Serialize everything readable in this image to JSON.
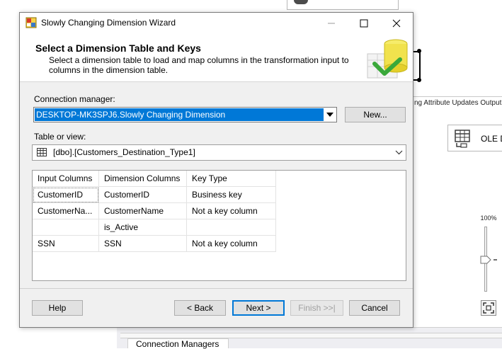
{
  "background": {
    "flow_label": "ng Attribute Updates Output",
    "ole_label": "OLE D",
    "zoom_label": "100%",
    "connection_managers_tab": "Connection Managers"
  },
  "dialog": {
    "title": "Slowly Changing Dimension Wizard",
    "header": {
      "title": "Select a Dimension Table and Keys",
      "description": "Select a dimension table to load and map columns in the transformation input to columns in the dimension table."
    },
    "connection_manager": {
      "label": "Connection manager:",
      "value": "DESKTOP-MK3SPJ6.Slowly Changing Dimension",
      "new_button": "New..."
    },
    "table_or_view": {
      "label": "Table or view:",
      "value": "[dbo].[Customers_Destination_Type1]"
    },
    "grid": {
      "headers": [
        "Input Columns",
        "Dimension Columns",
        "Key Type"
      ],
      "rows": [
        [
          "CustomerID",
          "CustomerID",
          "Business key"
        ],
        [
          "CustomerNa...",
          "CustomerName",
          "Not a key column"
        ],
        [
          "",
          "is_Active",
          ""
        ],
        [
          "SSN",
          "SSN",
          "Not a key column"
        ]
      ]
    },
    "buttons": {
      "help": "Help",
      "back": "< Back",
      "next": "Next >",
      "finish": "Finish >>|",
      "cancel": "Cancel"
    }
  },
  "colors": {
    "selection": "#0078d7",
    "dialog_bg": "#f0f0f0",
    "header_bg": "#ffffff"
  }
}
